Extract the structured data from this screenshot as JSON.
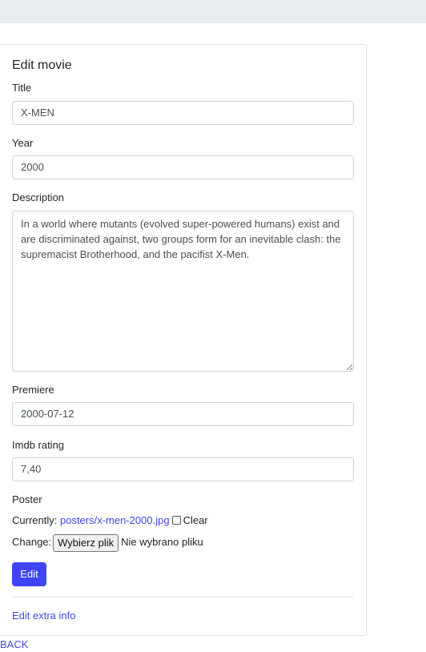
{
  "form": {
    "heading": "Edit movie",
    "title": {
      "label": "Title",
      "value": "X-MEN"
    },
    "year": {
      "label": "Year",
      "value": "2000"
    },
    "description": {
      "label": "Description",
      "value": "In a world where mutants (evolved super-powered humans) exist and are discriminated against, two groups form for an inevitable clash: the supremacist Brotherhood, and the pacifist X-Men."
    },
    "premiere": {
      "label": "Premiere",
      "value": "2000-07-12"
    },
    "imdb_rating": {
      "label": "Imdb rating",
      "value": "7,40"
    },
    "poster": {
      "label": "Poster",
      "currently_label": "Currently:",
      "current_file": "posters/x-men-2000.jpg",
      "clear_label": "Clear",
      "change_label": "Change:",
      "choose_button": "Wybierz plik",
      "no_file_text": "Nie wybrano pliku"
    },
    "submit_label": "Edit"
  },
  "links": {
    "extra_info": "Edit extra info",
    "back": "BACK"
  },
  "colors": {
    "accent": "#3f44f6",
    "link": "#4046e0",
    "topbar": "#e9ecef"
  }
}
